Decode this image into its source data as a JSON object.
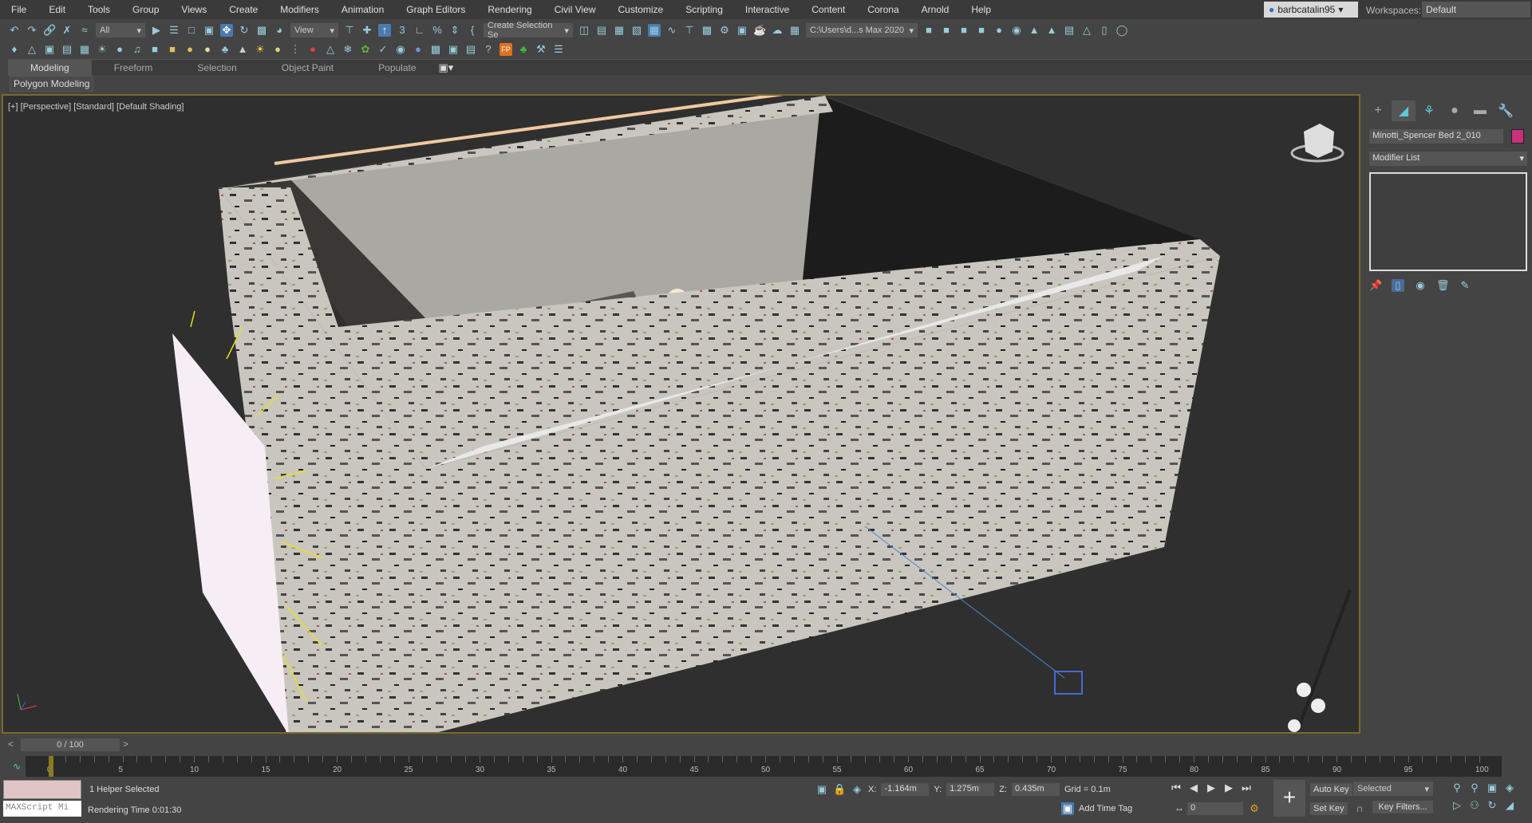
{
  "menu": [
    "File",
    "Edit",
    "Tools",
    "Group",
    "Views",
    "Create",
    "Modifiers",
    "Animation",
    "Graph Editors",
    "Rendering",
    "Civil View",
    "Customize",
    "Scripting",
    "Interactive",
    "Content",
    "Corona",
    "Arnold",
    "Help"
  ],
  "user": {
    "name": "barbcatalin95"
  },
  "workspace": {
    "label": "Workspaces:",
    "value": "Default"
  },
  "toolbar": {
    "selection_filter": "All",
    "ref_coord": "View",
    "named_selection": "Create Selection Se",
    "project_path": "C:\\Users\\d...s Max 2020"
  },
  "ribbon": {
    "tabs": [
      "Modeling",
      "Freeform",
      "Selection",
      "Object Paint",
      "Populate"
    ],
    "active": "Modeling",
    "panel": "Polygon Modeling"
  },
  "viewport": {
    "label": "[+] [Perspective] [Standard] [Default Shading]"
  },
  "command_panel": {
    "object_name": "Minotti_Spencer Bed 2_010",
    "object_color": "#c8307c",
    "modifier_list": "Modifier List"
  },
  "timeline": {
    "frame": "0 / 100",
    "ticks": [
      "0",
      "5",
      "10",
      "15",
      "20",
      "25",
      "30",
      "35",
      "40",
      "45",
      "50",
      "55",
      "60",
      "65",
      "70",
      "75",
      "80",
      "85",
      "90",
      "95",
      "100"
    ],
    "current_frame": 0
  },
  "status": {
    "maxscript_placeholder": "MAXScript Mi",
    "selection": "1 Helper Selected",
    "render_time": "Rendering Time  0:01:30",
    "x": "-1.164m",
    "y": "1.275m",
    "z": "0.435m",
    "grid": "Grid = 0.1m",
    "add_time_tag": "Add Time Tag",
    "auto_key": "Auto Key",
    "set_key": "Set Key",
    "key_mode": "Selected",
    "key_filters": "Key Filters...",
    "frame_field": "0"
  },
  "colors": {
    "viewport_border": "#7b6a2a",
    "accent": "#5ac8d8"
  }
}
